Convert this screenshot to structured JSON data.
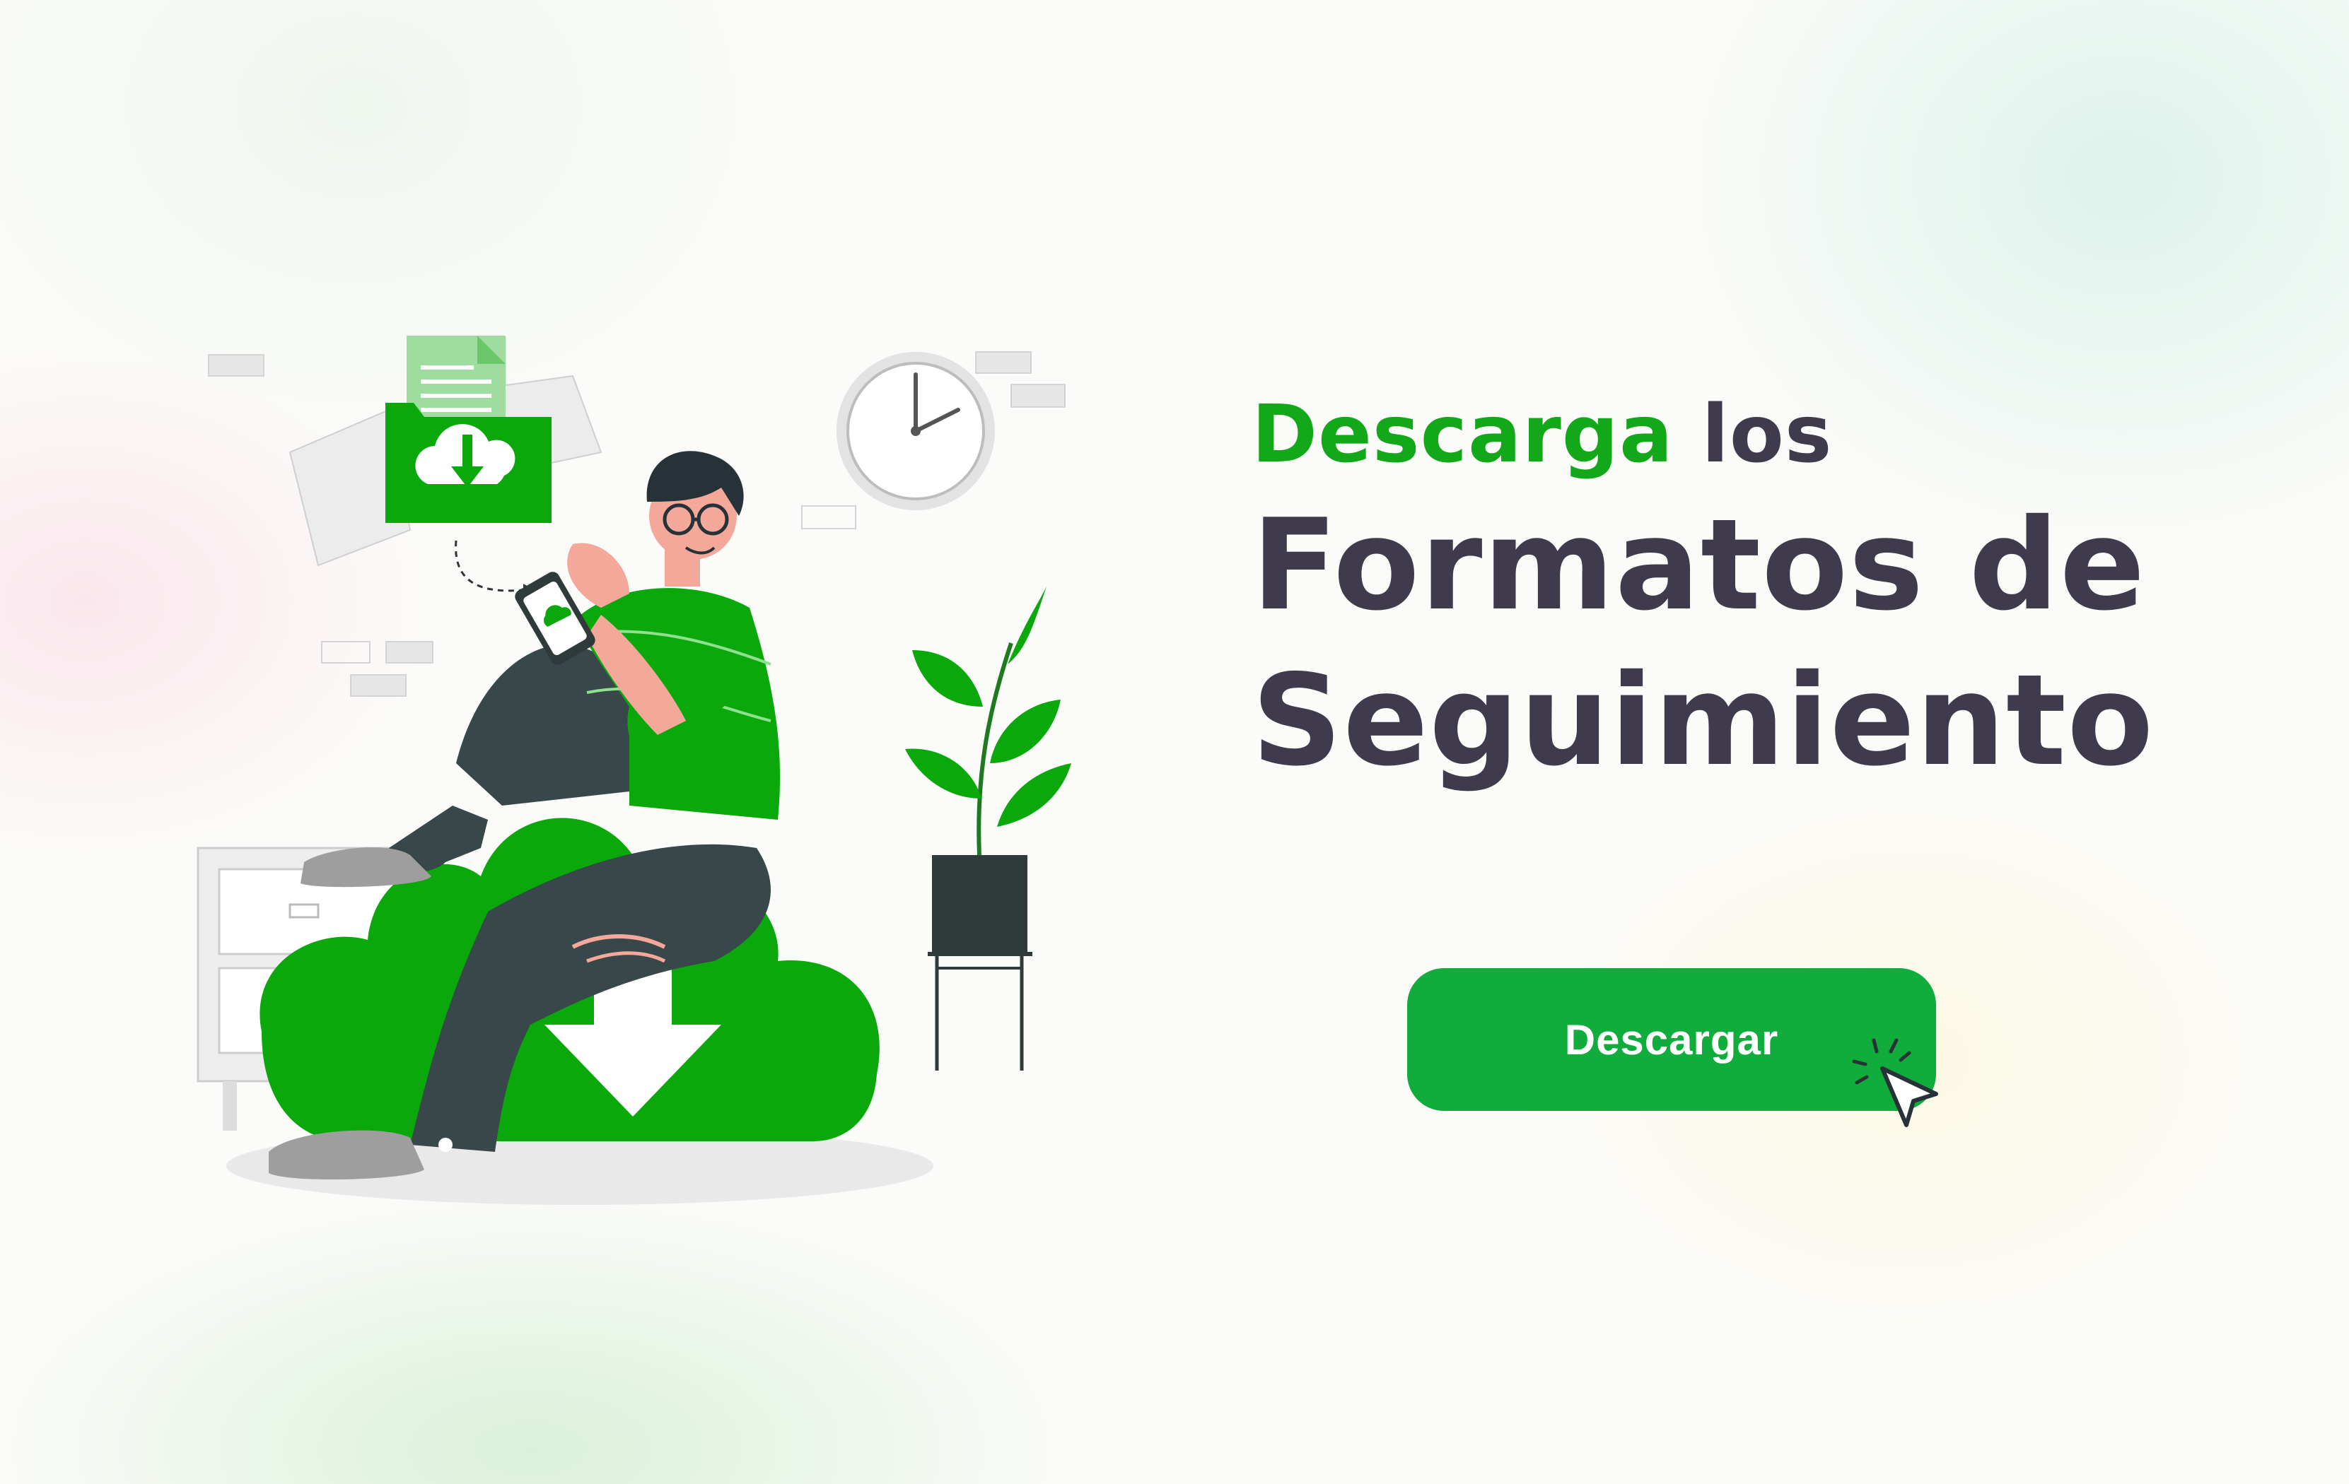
{
  "headline": {
    "accent_word": "Descarga",
    "line1_rest": " los",
    "line2": "Formatos de",
    "line3": "Seguimiento"
  },
  "cta": {
    "label": "Descargar"
  },
  "colors": {
    "accent": "#12a81a",
    "heading": "#403b4c",
    "button": "#11ad3c",
    "illustration_green": "#0aa80a"
  },
  "illustration": {
    "icons": [
      "folder-download-icon",
      "cloud-download-icon",
      "clock-icon",
      "plant-icon",
      "phone-icon",
      "cursor-click-icon"
    ]
  }
}
